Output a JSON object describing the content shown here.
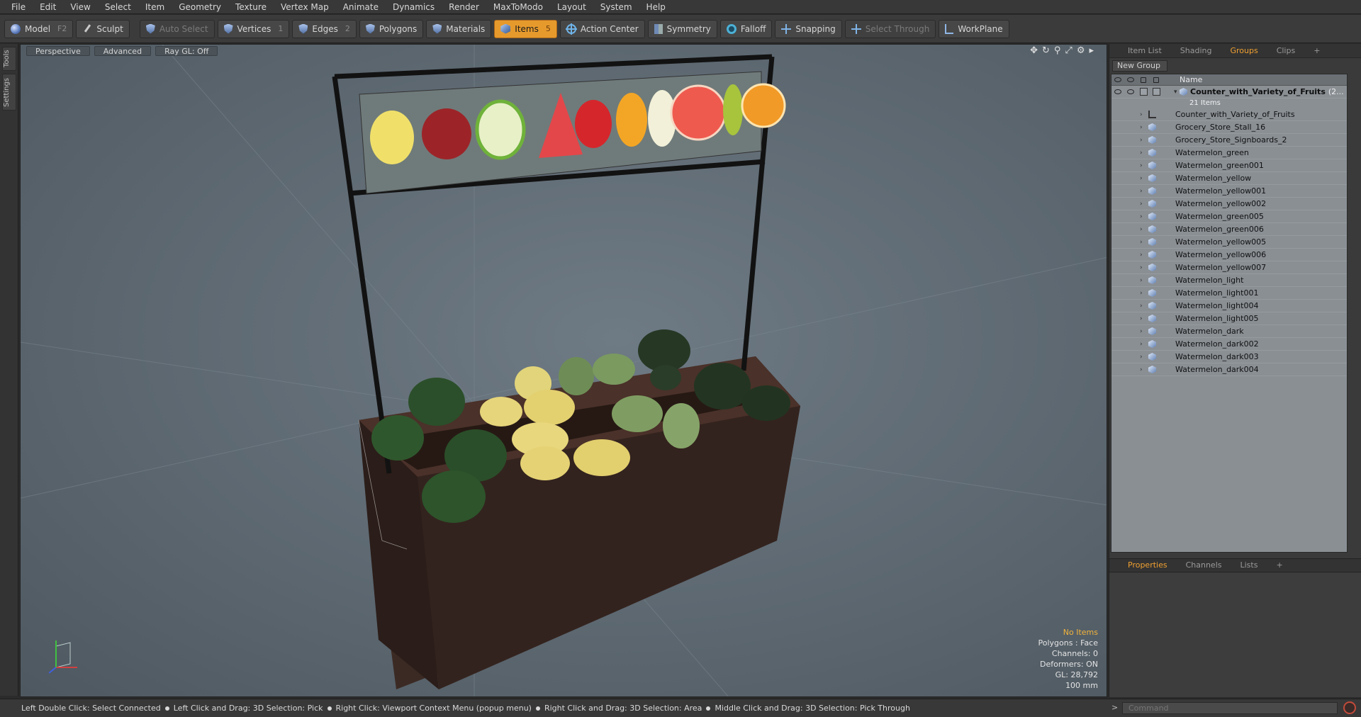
{
  "menu": [
    "File",
    "Edit",
    "View",
    "Select",
    "Item",
    "Geometry",
    "Texture",
    "Vertex Map",
    "Animate",
    "Dynamics",
    "Render",
    "MaxToModo",
    "Layout",
    "System",
    "Help"
  ],
  "toolbar": {
    "model": "Model",
    "model_key": "F2",
    "sculpt": "Sculpt",
    "auto_select": "Auto Select",
    "vertices": "Vertices",
    "vertices_key": "1",
    "edges": "Edges",
    "edges_key": "2",
    "polygons": "Polygons",
    "materials": "Materials",
    "items": "Items",
    "items_key": "5",
    "action_center": "Action Center",
    "symmetry": "Symmetry",
    "falloff": "Falloff",
    "snapping": "Snapping",
    "select_through": "Select Through",
    "workplane": "WorkPlane"
  },
  "lefttabs": [
    "Tools",
    "Settings"
  ],
  "viewport": {
    "view": "Perspective",
    "shading": "Advanced",
    "raygl": "Ray GL: Off",
    "info": {
      "selection": "No Items",
      "polygons": "Polygons : Face",
      "channels": "Channels: 0",
      "deformers": "Deformers: ON",
      "gl": "GL: 28,792",
      "scale": "100 mm"
    }
  },
  "rightpanel": {
    "tabs": [
      "Item List",
      "Shading",
      "Groups",
      "Clips",
      "+"
    ],
    "active_tab": "Groups",
    "new_group": "New Group",
    "name_header": "Name",
    "group_name": "Counter_with_Variety_of_Fruits",
    "group_count_short": "(2...",
    "group_count": "21 Items",
    "items": [
      "Counter_with_Variety_of_Fruits",
      "Grocery_Store_Stall_16",
      "Grocery_Store_Signboards_2",
      "Watermelon_green",
      "Watermelon_green001",
      "Watermelon_yellow",
      "Watermelon_yellow001",
      "Watermelon_yellow002",
      "Watermelon_green005",
      "Watermelon_green006",
      "Watermelon_yellow005",
      "Watermelon_yellow006",
      "Watermelon_yellow007",
      "Watermelon_light",
      "Watermelon_light001",
      "Watermelon_light004",
      "Watermelon_light005",
      "Watermelon_dark",
      "Watermelon_dark002",
      "Watermelon_dark003",
      "Watermelon_dark004"
    ],
    "bottom_tabs": [
      "Properties",
      "Channels",
      "Lists",
      "+"
    ],
    "bottom_active": "Properties"
  },
  "statusbar": {
    "hints": [
      "Left Double Click: Select Connected",
      "Left Click and Drag: 3D Selection: Pick",
      "Right Click: Viewport Context Menu (popup menu)",
      "Right Click and Drag: 3D Selection: Area",
      "Middle Click and Drag: 3D Selection: Pick Through"
    ],
    "command_placeholder": "Command"
  },
  "colors": {
    "accent": "#e79a2c",
    "viewport_bg": "#5d6871",
    "panel_bg": "#3a3a3a"
  }
}
